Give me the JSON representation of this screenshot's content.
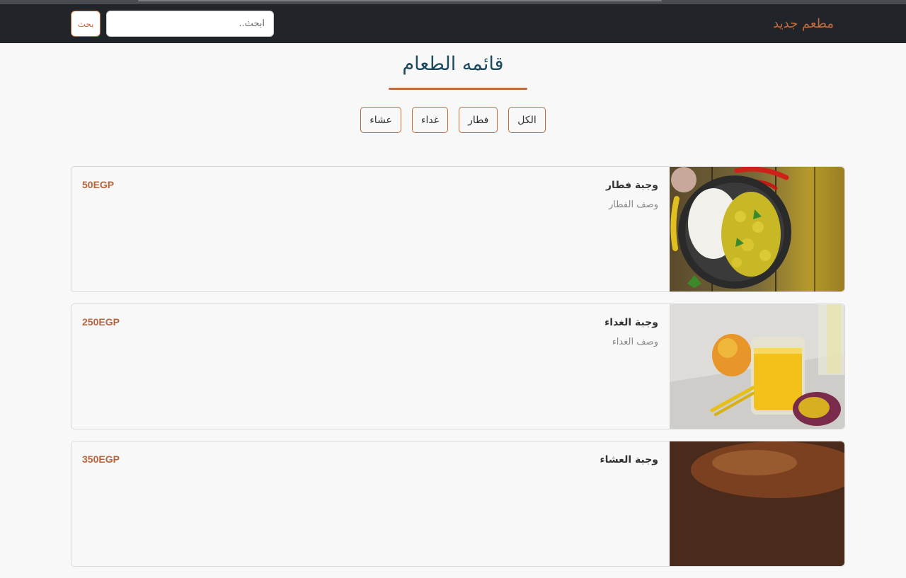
{
  "navbar": {
    "brand": "مطعم جديد",
    "search_placeholder": "ابحث..",
    "search_button": "بحث"
  },
  "page": {
    "title": "قائمه الطعام"
  },
  "filters": [
    "الكل",
    "فطار",
    "غداء",
    "عشاء"
  ],
  "items": [
    {
      "name": "وجبة فطار",
      "description": "وصف الفطار",
      "price": "50EGP"
    },
    {
      "name": "وجبة الغداء",
      "description": "وصف الغداء",
      "price": "250EGP"
    },
    {
      "name": "وجبة العشاء",
      "description": "",
      "price": "350EGP"
    }
  ],
  "colors": {
    "accent": "#c46b3d",
    "navbar_bg": "#212529",
    "title": "#1f4a5e"
  }
}
